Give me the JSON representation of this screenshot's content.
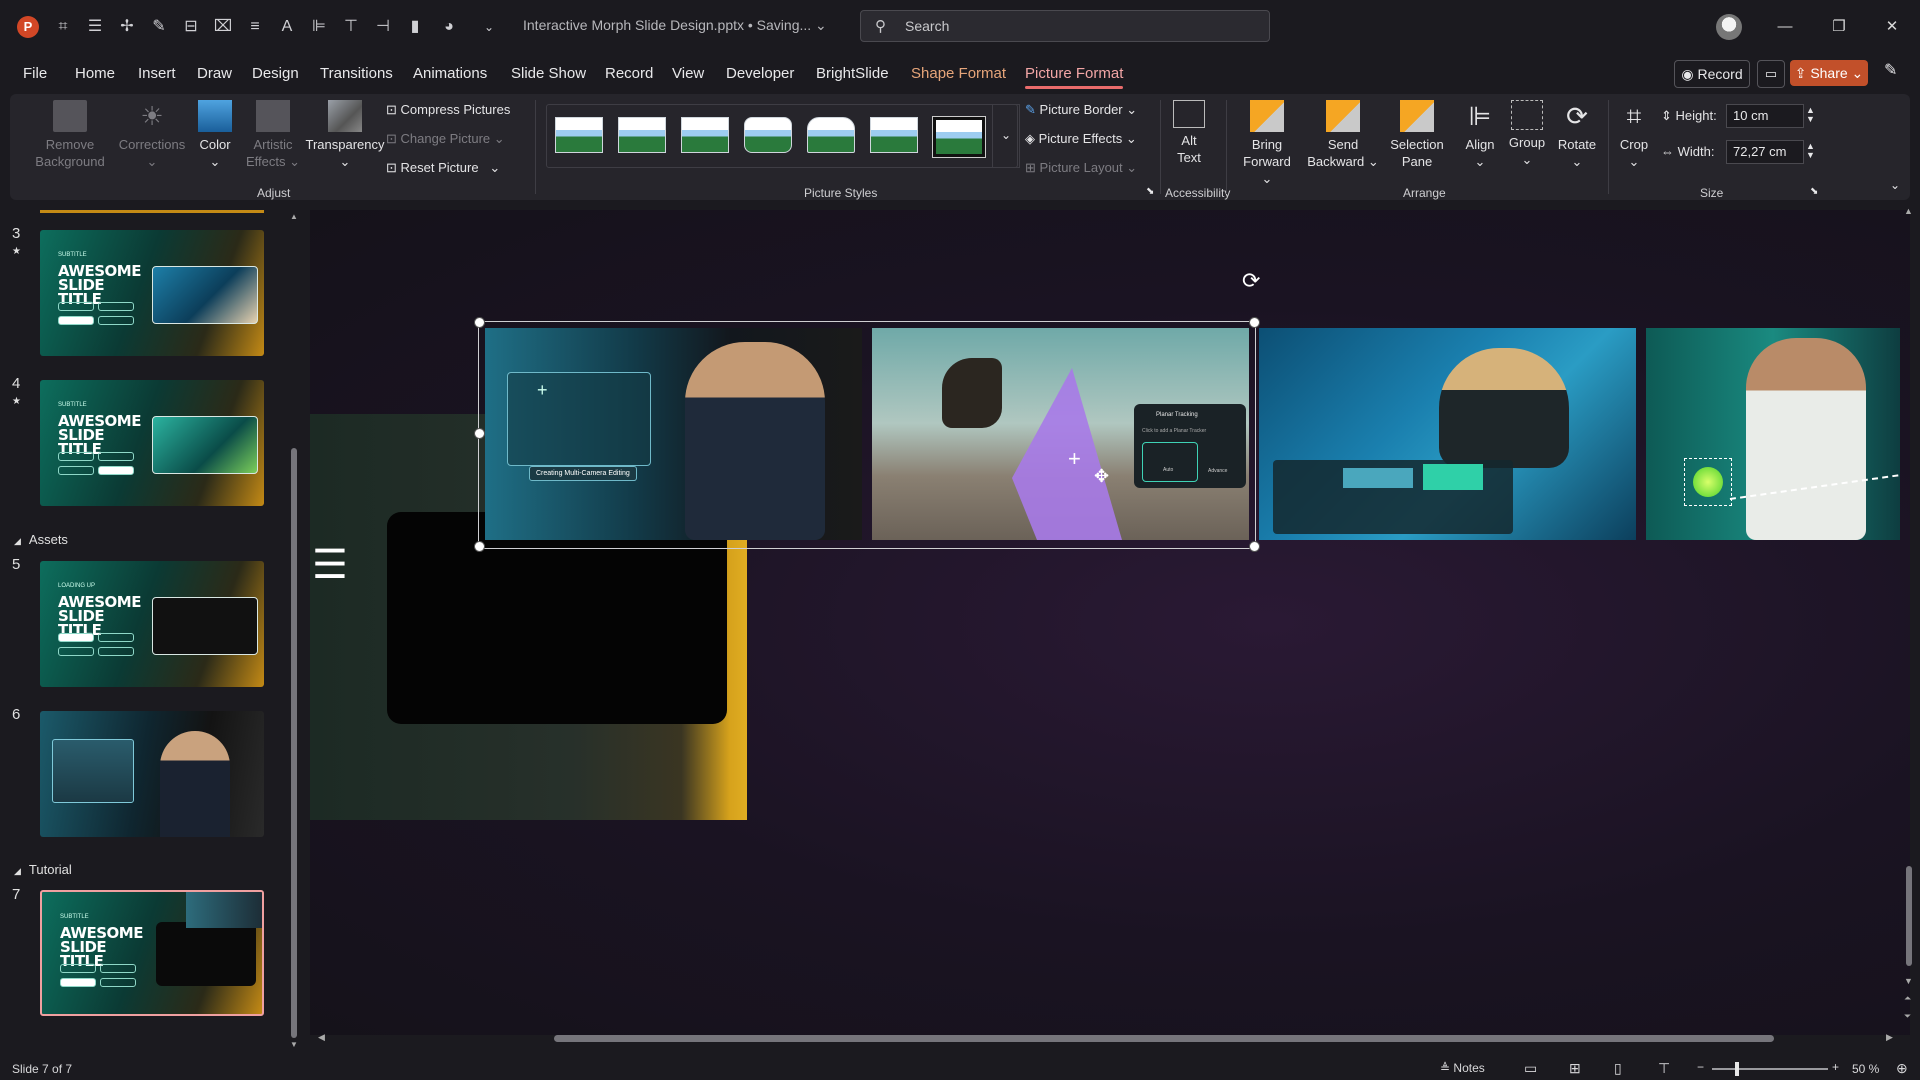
{
  "titlebar": {
    "app_icon": "powerpoint-icon",
    "file_title": "Interactive Morph Slide Design.pptx • Saving... ⌄",
    "search_placeholder": "Search"
  },
  "menu": {
    "tabs": [
      "File",
      "Home",
      "Insert",
      "Draw",
      "Design",
      "Transitions",
      "Animations",
      "Slide Show",
      "Record",
      "View",
      "Developer",
      "BrightSlide",
      "Shape Format",
      "Picture Format"
    ],
    "record_label": "Record",
    "share_label": "Share"
  },
  "ribbon": {
    "adjust": {
      "remove_background": "Remove Background",
      "corrections": "Corrections",
      "color": "Color",
      "artistic_effects": "Artistic Effects",
      "transparency": "Transparency",
      "compress": "Compress Pictures",
      "change": "Change Picture",
      "reset": "Reset Picture",
      "group_label": "Adjust"
    },
    "picture_styles": {
      "group_label": "Picture Styles",
      "border": "Picture Border",
      "effects": "Picture Effects",
      "layout": "Picture Layout"
    },
    "accessibility": {
      "alt_text": "Alt Text",
      "group_label": "Accessibility"
    },
    "arrange": {
      "bring_forward": "Bring Forward",
      "send_backward": "Send Backward",
      "selection_pane": "Selection Pane",
      "align": "Align",
      "group": "Group",
      "rotate": "Rotate",
      "group_label": "Arrange"
    },
    "size": {
      "crop": "Crop",
      "height_label": "Height:",
      "height_value": "10 cm",
      "width_label": "Width:",
      "width_value": "72,27 cm",
      "group_label": "Size"
    }
  },
  "slides_pane": {
    "sections": {
      "assets": "Assets",
      "tutorial": "Tutorial"
    },
    "thumbs": [
      {
        "num": "3",
        "title": "AWESOME SLIDE TITLE",
        "subtitle": "SUBTITLE"
      },
      {
        "num": "4",
        "title": "AWESOME SLIDE TITLE",
        "subtitle": "SUBTITLE"
      },
      {
        "num": "5",
        "title": "AWESOME SLIDE TITLE",
        "subtitle": "LOADING UP"
      },
      {
        "num": "6",
        "title": "",
        "subtitle": ""
      },
      {
        "num": "7",
        "title": "AWESOME SLIDE TITLE",
        "subtitle": "SUBTITLE"
      }
    ]
  },
  "canvas": {
    "image1_caption": "Creating Multi-Camera Editing",
    "image2_panel_title": "Planar Tracking",
    "image2_panel_sub": "Click to add a Planar Tracker",
    "image2_btn_auto": "Auto",
    "image2_btn_advance": "Advance"
  },
  "statusbar": {
    "slide_count": "Slide 7 of 7",
    "notes": "Notes",
    "zoom": "50 %"
  }
}
